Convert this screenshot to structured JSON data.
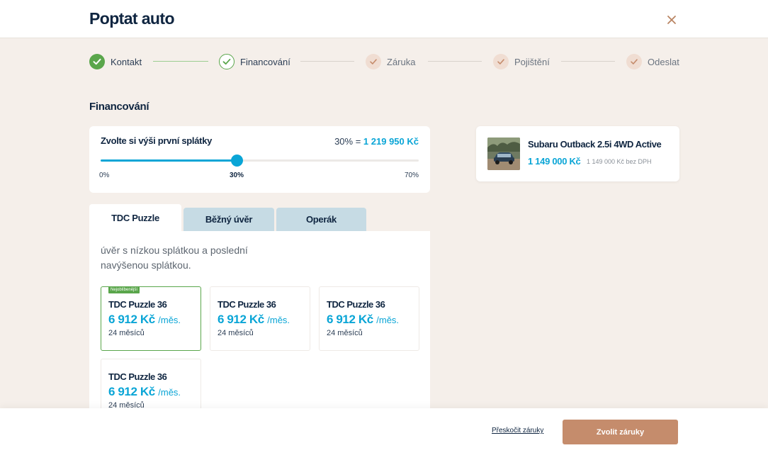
{
  "header": {
    "title": "Poptat auto",
    "close_icon": "close-icon"
  },
  "stepper": {
    "steps": [
      {
        "label": "Kontakt",
        "state": "done"
      },
      {
        "label": "Financování",
        "state": "current"
      },
      {
        "label": "Záruka",
        "state": "pending"
      },
      {
        "label": "Pojištění",
        "state": "pending"
      },
      {
        "label": "Odeslat",
        "state": "pending"
      }
    ]
  },
  "financing": {
    "title": "Financování",
    "down_payment": {
      "question": "Zvolte si výši první splátky",
      "value_prefix": "30% =",
      "value_amount": "1 219 950 Kč",
      "min_label": "0%",
      "current_label": "30%",
      "max_label": "70%",
      "min": 0,
      "max": 70,
      "current": 30
    },
    "tabs": [
      {
        "label": "TDC Puzzle",
        "active": true
      },
      {
        "label": "Běžný úvěr",
        "active": false
      },
      {
        "label": "Operák",
        "active": false
      }
    ],
    "description": "úvěr s nízkou splátkou a poslední navýšenou splátkou.",
    "offers": [
      {
        "badge": "Nejoblíbenější",
        "name": "TDC Puzzle 36",
        "price": "6 912 Kč",
        "unit": "/měs.",
        "duration": "24 měsíců",
        "selected": true
      },
      {
        "name": "TDC Puzzle 36",
        "price": "6 912 Kč",
        "unit": "/měs.",
        "duration": "24 měsíců",
        "selected": false
      },
      {
        "name": "TDC Puzzle 36",
        "price": "6 912 Kč",
        "unit": "/měs.",
        "duration": "24 měsíců",
        "selected": false
      },
      {
        "name": "TDC Puzzle 36",
        "price": "6 912 Kč",
        "unit": "/měs.",
        "duration": "24 měsíců",
        "selected": false
      }
    ]
  },
  "car": {
    "name": "Subaru Outback 2.5i 4WD Active",
    "price": "1 149 000 Kč",
    "price_net": "1 149 000 Kč bez DPH"
  },
  "footer": {
    "skip_label": "Přeskočit záruky",
    "cta_label": "Zvolit záruky"
  },
  "colors": {
    "accent": "#0aa5d6",
    "success": "#5aa64b",
    "cta": "#c58c6c",
    "navy": "#0f2540",
    "page_bg": "#f5efea"
  }
}
